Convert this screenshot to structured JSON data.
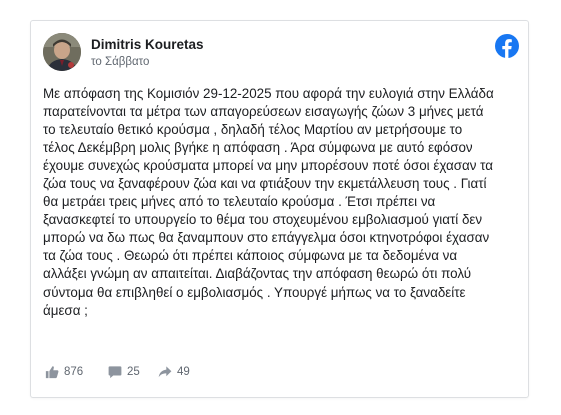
{
  "post": {
    "author": "Dimitris Kouretas",
    "timestamp": "το Σάββατο",
    "body": "Με απόφαση της Κομισιόν 29-12-2025 που αφορά την ευλογιά στην Ελλάδα\nπαρατείνονται τα μέτρα των απαγορεύσεων εισαγωγής ζώων 3 μήνες μετά\nτο τελευταίο θετικό κρούσμα , δηλαδή τέλος Μαρτίου αν μετρήσουμε το\nτέλος Δεκέμβρη μολις βγήκε η απόφαση . Άρα σύμφωνα με αυτό εφόσον\nέχουμε συνεχώς κρούσματα μπορεί να μην μπορέσουν ποτέ όσοι έχασαν τα\nζώα τους να ξαναφέρουν ζώα και να φτιάξουν την εκμετάλλευση τους . Γιατί\nθα μετράει τρεις μήνες από το τελευταίο κρούσμα . Έτσι πρέπει να\nξανασκεφτεί το υπουργείο το θέμα του στοχευμένου εμβολιασμού γιατί δεν\nμπορώ να δω πως θα ξαναμπουν στο επάγγελμα όσοι κτηνοτρόφοι έχασαν\nτα ζώα τους . Θεωρώ ότι πρέπει κάποιος σύμφωνα με τα δεδομένα να\nαλλάξει γνώμη αν απαιτείται. Διαβάζοντας την απόφαση θεωρώ ότι πολύ\nσύντομα θα επιβληθεί ο εμβολιασμός . Υπουργέ μήπως να το ξαναδείτε\nάμεσα ;"
  },
  "stats": {
    "likes": "876",
    "comments": "25",
    "shares": "49"
  },
  "icons": {
    "platform_logo": "facebook-logo-icon",
    "likes": "thumbs-up-icon",
    "comments": "comment-icon",
    "shares": "share-arrow-icon"
  },
  "colors": {
    "brand_blue": "#1877f2",
    "text": "#1c1e21",
    "secondary_text": "#606770",
    "border": "#dddfe2"
  }
}
